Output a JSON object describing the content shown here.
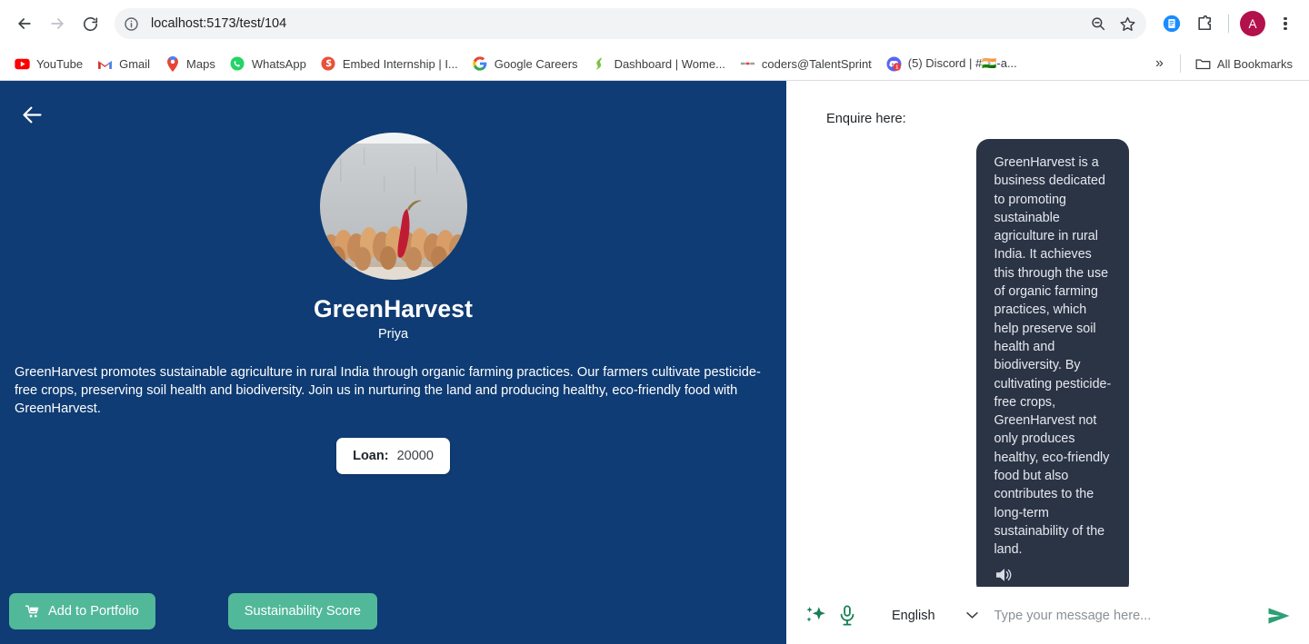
{
  "browser": {
    "back_title": "Back",
    "forward_title": "Forward",
    "reload_title": "Reload",
    "url": "localhost:5173/test/104",
    "site_info_icon": "info-circle-icon",
    "zoom_out_icon": "zoom-out-icon",
    "bookmark_star_icon": "star-icon",
    "extension_icon": "extension-puzzle-icon",
    "reading_list_icon": "reading-list-icon",
    "profile_initial": "A",
    "menu_icon": "three-dot-menu-icon",
    "bookmarks": [
      {
        "label": "YouTube",
        "icon": "youtube-icon"
      },
      {
        "label": "Gmail",
        "icon": "gmail-icon"
      },
      {
        "label": "Maps",
        "icon": "google-maps-icon"
      },
      {
        "label": "WhatsApp",
        "icon": "whatsapp-icon"
      },
      {
        "label": "Embed Internship | I...",
        "icon": "embed-internship-icon"
      },
      {
        "label": "Google Careers",
        "icon": "google-icon"
      },
      {
        "label": "Dashboard | Wome...",
        "icon": "dashboard-icon"
      },
      {
        "label": "coders@TalentSprint",
        "icon": "talentsprint-icon"
      },
      {
        "label": "(5) Discord | #🇮🇳-a...",
        "icon": "discord-icon"
      }
    ],
    "overflow_label": "»",
    "all_bookmarks_label": "All Bookmarks",
    "all_bookmarks_icon": "folder-icon"
  },
  "profile": {
    "back_icon": "back-arrow-icon",
    "avatar_alt": "chili-pepper-and-nuts-photo",
    "business_name": "GreenHarvest",
    "owner_name": "Priya",
    "description": "GreenHarvest promotes sustainable agriculture in rural India through organic farming practices. Our farmers cultivate pesticide-free crops, preserving soil health and biodiversity. Join us in nurturing the land and producing healthy, eco-friendly food with GreenHarvest.",
    "loan_label": "Loan:",
    "loan_value": "20000",
    "buttons": {
      "add_to_portfolio": "Add to Portfolio",
      "add_to_portfolio_icon": "shopping-cart-icon",
      "sustainability_score": "Sustainability Score"
    }
  },
  "chat": {
    "heading": "Enquire here:",
    "message": "GreenHarvest is a business dedicated to promoting sustainable agriculture in rural India. It achieves this through the use of organic farming practices, which help preserve soil health and biodiversity. By cultivating pesticide-free crops, GreenHarvest not only produces healthy, eco-friendly food but also contributes to the long-term sustainability of the land.",
    "speaker_icon": "speaker-volume-icon",
    "sparkle_icon": "ai-sparkle-icon",
    "mic_icon": "microphone-icon",
    "language_selected": "English",
    "language_chevron_icon": "chevron-down-icon",
    "input_placeholder": "Type your message here...",
    "input_value": "",
    "send_icon": "send-paper-plane-icon"
  },
  "colors": {
    "panel_blue": "#0f3c74",
    "accent_green": "#52b89a",
    "bubble_dark": "#2b3445",
    "send_green": "#2e9e76",
    "avatar_badge": "#b3114b"
  }
}
